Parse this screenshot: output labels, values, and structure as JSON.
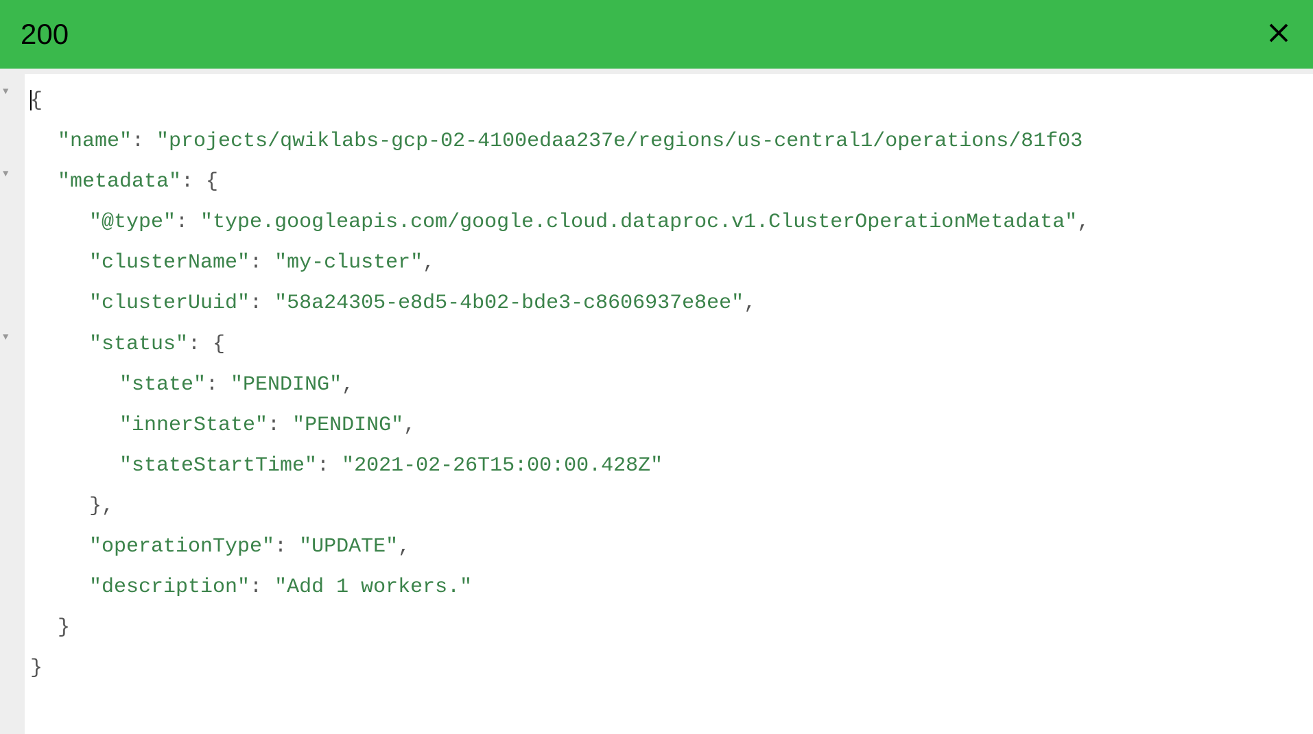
{
  "header": {
    "status_code": "200"
  },
  "json": {
    "line1": "{",
    "line2_key": "\"name\"",
    "line2_val": "\"projects/qwiklabs-gcp-02-4100edaa237e/regions/us-central1/operations/81f03",
    "line3_key": "\"metadata\"",
    "line3_val": "{",
    "line4_key": "\"@type\"",
    "line4_val": "\"type.googleapis.com/google.cloud.dataproc.v1.ClusterOperationMetadata\"",
    "line5_key": "\"clusterName\"",
    "line5_val": "\"my-cluster\"",
    "line6_key": "\"clusterUuid\"",
    "line6_val": "\"58a24305-e8d5-4b02-bde3-c8606937e8ee\"",
    "line7_key": "\"status\"",
    "line7_val": "{",
    "line8_key": "\"state\"",
    "line8_val": "\"PENDING\"",
    "line9_key": "\"innerState\"",
    "line9_val": "\"PENDING\"",
    "line10_key": "\"stateStartTime\"",
    "line10_val": "\"2021-02-26T15:00:00.428Z\"",
    "line11": "},",
    "line12_key": "\"operationType\"",
    "line12_val": "\"UPDATE\"",
    "line13_key": "\"description\"",
    "line13_val": "\"Add 1 workers.\"",
    "line14": "}",
    "line15": "}"
  }
}
